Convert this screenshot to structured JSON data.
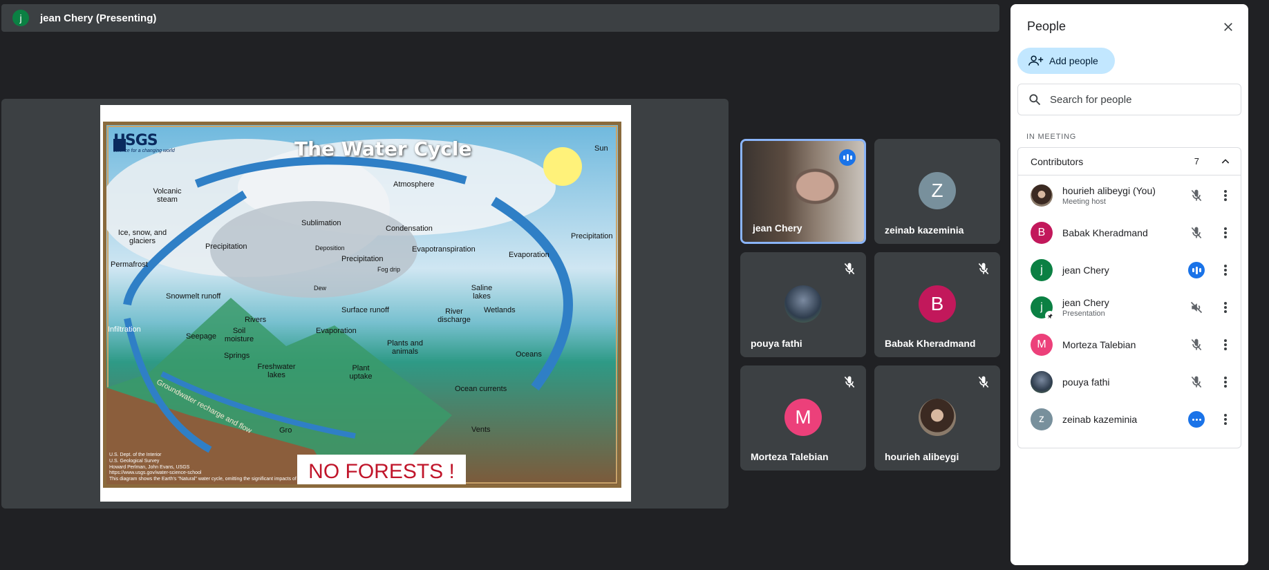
{
  "presenter_bar": {
    "avatar_letter": "j",
    "title": "jean Chery (Presenting)"
  },
  "slide": {
    "logo": "USGS",
    "logo_sub": "science for a changing world",
    "title": "The Water Cycle",
    "banner": "NO FORESTS !",
    "credits": [
      "U.S. Dept. of the Interior",
      "U.S. Geological Survey",
      "Howard Perlman, John Evans, USGS",
      "https://www.usgs.gov/water-science-school",
      "This diagram shows the Earth's \"Natural\" water cycle, omitting the significant impacts of"
    ],
    "labels": {
      "sun": "Sun",
      "atmosphere": "Atmosphere",
      "volcanic": "Volcanic steam",
      "ice": "Ice, snow, and glaciers",
      "sublimation": "Sublimation",
      "deposition": "Deposition",
      "condensation": "Condensation",
      "precip_left": "Precipitation",
      "precip_mid": "Precipitation",
      "precip_right": "Precipitation",
      "evapotranspiration": "Evapotranspiration",
      "evaporation_right": "Evaporation",
      "fog": "Fog drip",
      "permafrost": "Permafrost",
      "snowmelt": "Snowmelt runoff",
      "dew": "Dew",
      "saline": "Saline lakes",
      "surface": "Surface runoff",
      "rivers": "Rivers",
      "river_discharge": "River discharge",
      "wetlands": "Wetlands",
      "infiltration": "Infiltration",
      "seepage": "Seepage",
      "soil": "Soil moisture",
      "evaporation_mid": "Evaporation",
      "springs": "Springs",
      "plants": "Plants and animals",
      "oceans": "Oceans",
      "freshwater": "Freshwater lakes",
      "uptake": "Plant uptake",
      "groundwater": "Groundwater recharge and flow",
      "ocean_currents": "Ocean currents",
      "vents": "Vents",
      "gro": "Gro"
    }
  },
  "tiles": [
    {
      "name": "jean Chery",
      "type": "video",
      "speaking": true
    },
    {
      "name": "zeinab kazeminia",
      "letter": "Z",
      "color": "#78909c"
    },
    {
      "name": "pouya fathi",
      "type": "photo",
      "muted": true
    },
    {
      "name": "Babak Kheradmand",
      "letter": "B",
      "color": "#c2185b",
      "muted": true
    },
    {
      "name": "Morteza Talebian",
      "letter": "M",
      "color": "#ec407a",
      "muted": true
    },
    {
      "name": "hourieh alibeygi",
      "type": "photo",
      "muted": true
    }
  ],
  "panel": {
    "title": "People",
    "add_label": "Add people",
    "search_placeholder": "Search for people",
    "section": "IN MEETING",
    "group": {
      "label": "Contributors",
      "count": "7"
    },
    "people": [
      {
        "name": "hourieh alibeygi (You)",
        "sub": "Meeting host",
        "status": "muted",
        "avatar": "photo"
      },
      {
        "name": "Babak Kheradmand",
        "sub": "",
        "status": "muted",
        "letter": "B",
        "color": "#c2185b"
      },
      {
        "name": "jean Chery",
        "sub": "",
        "status": "speaking",
        "letter": "j",
        "color": "#0b8043"
      },
      {
        "name": "jean Chery",
        "sub": "Presentation",
        "status": "audio-off",
        "letter": "j",
        "color": "#0b8043"
      },
      {
        "name": "Morteza Talebian",
        "sub": "",
        "status": "muted",
        "letter": "M",
        "color": "#ec407a"
      },
      {
        "name": "pouya fathi",
        "sub": "",
        "status": "muted",
        "avatar": "photo"
      },
      {
        "name": "zeinab kazeminia",
        "sub": "",
        "status": "more",
        "letter": "z",
        "color": "#78909c"
      }
    ]
  },
  "colors": {
    "accent": "#1a73e8",
    "background": "#202124",
    "tile": "#3c4043",
    "banner_text": "#c0152a"
  }
}
